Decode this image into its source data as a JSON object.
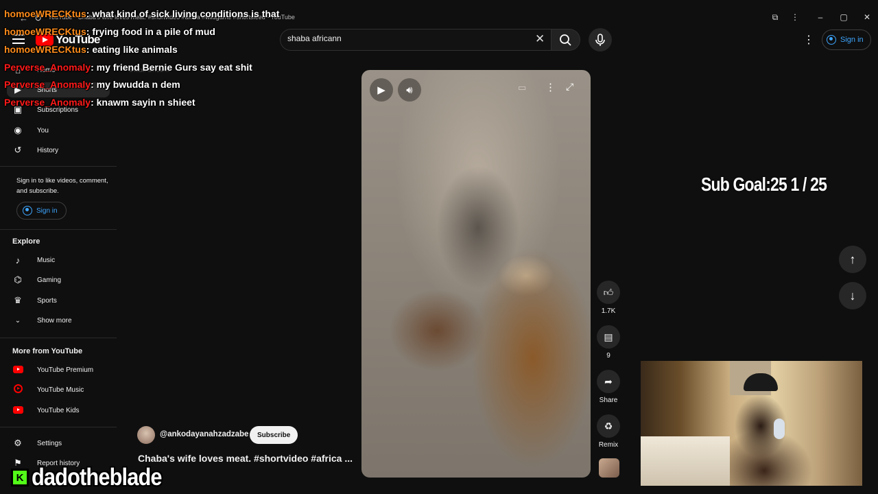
{
  "window": {
    "title": "YouTube - Chaba's wife loves meat. #shortvideo #africa #wildgame #shortsfeed - YouTube"
  },
  "header": {
    "logo_text": "YouTube",
    "search_value": "shaba africann",
    "sign_in": "Sign in"
  },
  "sidebar": {
    "home": "Home",
    "shorts": "Shorts",
    "subscriptions": "Subscriptions",
    "you": "You",
    "history": "History",
    "signin_prompt": "Sign in to like videos, comment, and subscribe.",
    "signin_button": "Sign in",
    "explore_heading": "Explore",
    "explore": [
      "Music",
      "Gaming",
      "Sports",
      "Show more"
    ],
    "more_heading": "More from YouTube",
    "more": [
      "YouTube Premium",
      "YouTube Music",
      "YouTube Kids"
    ],
    "settings": "Settings",
    "report_history": "Report history"
  },
  "breadcrumb_ghost": "shaba africann",
  "short": {
    "channel": "@ankodayanahzadzabe",
    "subscribe": "Subscribe",
    "title": "Chaba's wife loves meat. #shortvideo #africa ...",
    "likes": "1.7K",
    "comments": "9",
    "share": "Share",
    "remix": "Remix"
  },
  "chat": [
    {
      "user": "homoeWRECKtus",
      "message": ": what kind of sick living conditions is that"
    },
    {
      "user": "homoeWRECKtus",
      "message": ": frying food in a pile of mud"
    },
    {
      "user": "homoeWRECKtus",
      "message": ": eating like animals"
    },
    {
      "user": "Perverse_Anomaly",
      "message": ": my friend Bernie Gurs say eat shit"
    },
    {
      "user": "Perverse_Anomaly",
      "message": ": my bwudda n dem"
    },
    {
      "user": "Perverse_Anomaly",
      "message": ": knawm sayin n shieet"
    }
  ],
  "sub_goal": "Sub Goal:25  1 / 25",
  "streamer": {
    "platform_letter": "K",
    "name": "dadotheblade"
  },
  "colors": {
    "bg": "#0f0f0f",
    "accent_blue": "#3ea6ff",
    "yt_red": "#ff0000",
    "chat_user1": "#ff8c1a",
    "chat_user2": "#ff1a1a",
    "kick_green": "#53fc18"
  }
}
